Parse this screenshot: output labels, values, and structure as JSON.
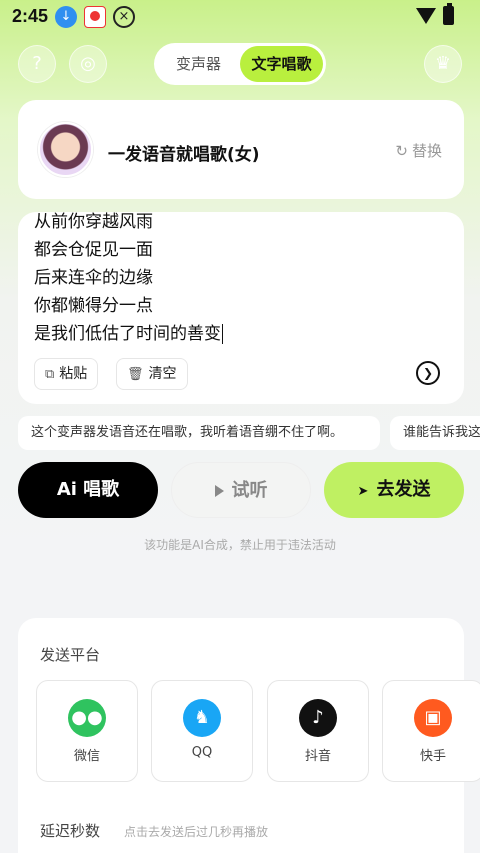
{
  "status": {
    "time": "2:45"
  },
  "header": {
    "help_icon": "?",
    "tabs": [
      {
        "label": "变声器",
        "active": false
      },
      {
        "label": "文字唱歌",
        "active": true
      }
    ]
  },
  "voice": {
    "name": "一发语音就唱歌(女)",
    "replace_label": "替换"
  },
  "lyrics": {
    "lines": [
      "从前你穿越风雨",
      "都会仓促见一面",
      "后来连伞的边缘",
      "你都懒得分一点",
      "是我们低估了时间的善变"
    ],
    "paste_label": "粘贴",
    "clear_label": "清空"
  },
  "suggestions": [
    "这个变声器发语音还在唱歌，我听着语音绷不住了啊。",
    "谁能告诉我这"
  ],
  "actions": {
    "sing_label": "Ai 唱歌",
    "listen_label": "试听",
    "send_label": "去发送"
  },
  "disclaimer": "该功能是AI合成，禁止用于违法活动",
  "platform": {
    "title": "发送平台",
    "items": [
      {
        "label": "微信"
      },
      {
        "label": "QQ"
      },
      {
        "label": "抖音"
      },
      {
        "label": "快手"
      }
    ]
  },
  "delay": {
    "title": "延迟秒数",
    "hint": "点击去发送后过几秒再播放"
  },
  "colors": {
    "accent": "#b9ef3e",
    "send": "#bff062",
    "sing": "#000000"
  }
}
